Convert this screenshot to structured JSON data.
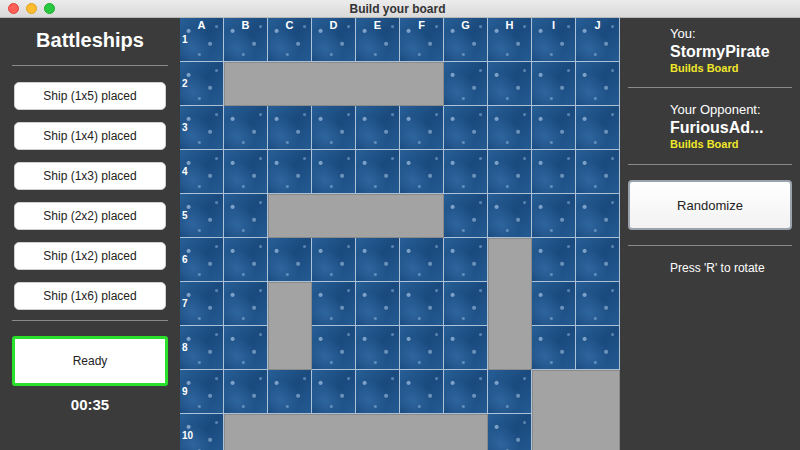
{
  "window": {
    "title": "Build your board"
  },
  "sidebar": {
    "title": "Battleships",
    "ships": [
      {
        "label": "Ship (1x5) placed"
      },
      {
        "label": "Ship (1x4) placed"
      },
      {
        "label": "Ship (1x3) placed"
      },
      {
        "label": "Ship (2x2) placed"
      },
      {
        "label": "Ship (1x2) placed"
      },
      {
        "label": "Ship (1x6) placed"
      }
    ],
    "ready_button": {
      "label": "Ready",
      "highlighted": true
    },
    "timer": "00:35"
  },
  "board": {
    "columns": [
      "A",
      "B",
      "C",
      "D",
      "E",
      "F",
      "G",
      "H",
      "I",
      "J"
    ],
    "rows": [
      "1",
      "2",
      "3",
      "4",
      "5",
      "6",
      "7",
      "8",
      "9",
      "10"
    ],
    "ships": [
      {
        "start": "B2",
        "end": "F2"
      },
      {
        "start": "C5",
        "end": "F5"
      },
      {
        "start": "H6",
        "end": "H8"
      },
      {
        "start": "I9",
        "end": "J10"
      },
      {
        "start": "C7",
        "end": "C8"
      },
      {
        "start": "B10",
        "end": "G10"
      }
    ]
  },
  "players": [
    {
      "label": "You:",
      "name": "StormyPirate",
      "status": "Builds Board"
    },
    {
      "label": "Your Opponent:",
      "name": "FuriousAd...",
      "status": "Builds Board"
    }
  ],
  "randomize_button": "Randomize",
  "hint": "Press 'R' to rotate"
}
